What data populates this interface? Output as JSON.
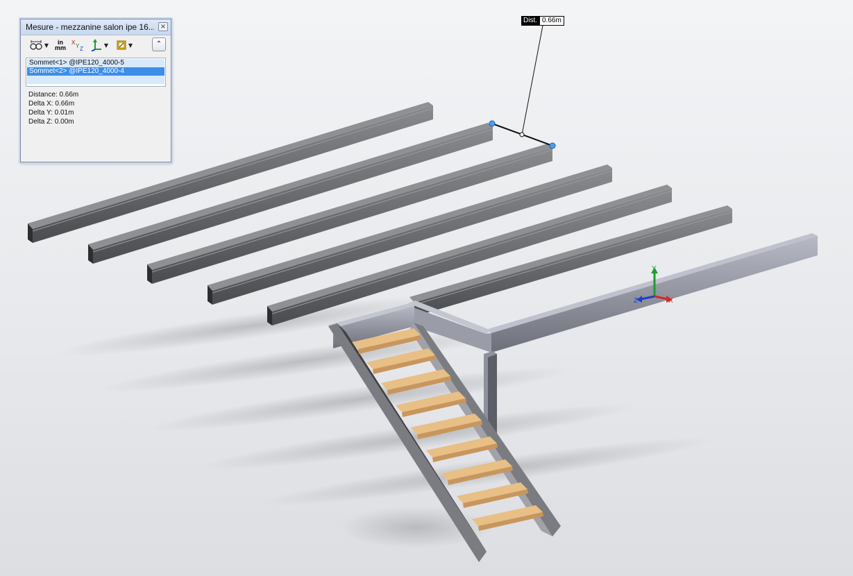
{
  "dialog": {
    "title": "Mesure - mezzanine salon ipe 16...",
    "close_glyph": "×",
    "toolbar": {
      "arc_icon": "arc-circle-measure-icon",
      "units_top": "in",
      "units_bottom": "mm",
      "xyz_icon": "xyz-delta-icon",
      "projection_icon": "projection-axis-icon",
      "history_icon": "measure-history-icon",
      "collapse_icon": "collapse-chevron-icon"
    },
    "selections": [
      "Sommet<1> @IPE120_4000-5",
      "Sommet<2> @IPE120_4000-4",
      ""
    ],
    "results": [
      "Distance: 0.66m",
      "Delta X: 0.66m",
      "Delta Y: 0.01m",
      "Delta Z: 0.00m"
    ]
  },
  "callout": {
    "label": "Dist.",
    "value": "0.66m"
  },
  "triad": {
    "y": "Y",
    "z": "Z",
    "x": "X"
  },
  "colors": {
    "beam_top": "#7e7f82",
    "beam_side": "#3c3d40",
    "beam_flange": "#5a5b5e",
    "frame_light": "#a6a9b4",
    "frame_dark": "#5d5f66",
    "tread_top": "#e8bf85",
    "tread_front": "#d7a46a",
    "highlight": "#3d8ee6"
  }
}
